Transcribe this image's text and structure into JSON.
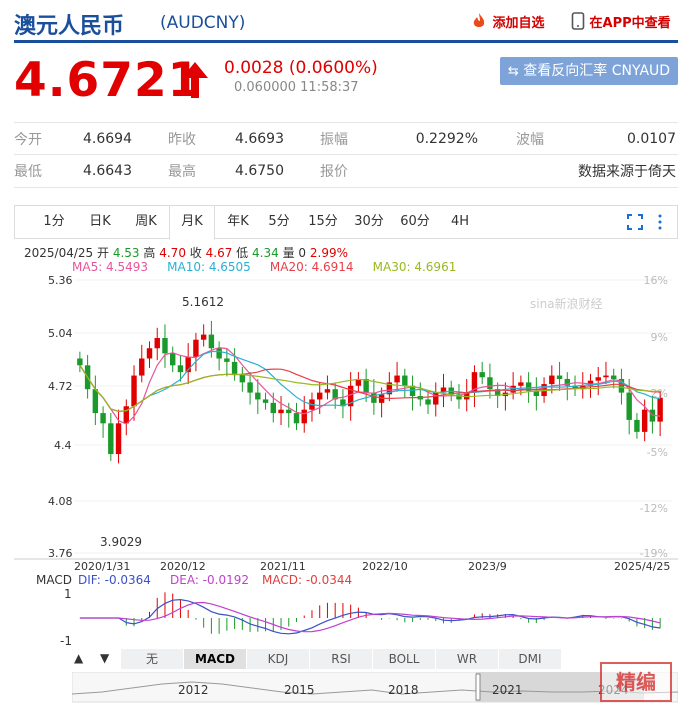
{
  "header": {
    "title": "澳元人民币",
    "code": "(AUDCNY)",
    "add_watchlist": "添加自选",
    "open_app": "在APP中查看"
  },
  "quote": {
    "price": "4.6721",
    "change": "0.0028 (0.0600%)",
    "bid_time": "0.060000 11:58:37",
    "reverse_button": "查看反向汇率 CNYAUD"
  },
  "stats": [
    [
      {
        "label": "今开",
        "value": "4.6694"
      },
      {
        "label": "昨收",
        "value": "4.6693"
      },
      {
        "label": "振幅",
        "value": "0.2292%"
      },
      {
        "label": "波幅",
        "value": "0.0107"
      }
    ],
    [
      {
        "label": "最低",
        "value": "4.6643"
      },
      {
        "label": "最高",
        "value": "4.6750"
      },
      {
        "label": "报价",
        "value": ""
      },
      {
        "label": "",
        "value": "数据来源于倚天"
      }
    ]
  ],
  "period_tabs": [
    "1分",
    "日K",
    "周K",
    "月K",
    "年K",
    "5分",
    "15分",
    "30分",
    "60分",
    "4H"
  ],
  "active_tab": "月K",
  "legend": {
    "date": "2025/04/25",
    "open_label": "开",
    "open": "4.53",
    "high_label": "高",
    "high": "4.70",
    "close_label": "收",
    "close": "4.67",
    "low_label": "低",
    "low": "4.34",
    "vol_label": "量",
    "vol": "0",
    "pct": "2.99%",
    "ma5": "MA5: 4.5493",
    "ma10": "MA10: 4.6505",
    "ma20": "MA20: 4.6914",
    "ma30": "MA30: 4.6961"
  },
  "colors": {
    "up": "#e00000",
    "down": "#1a9a2a",
    "ma5": "#e8559a",
    "ma10": "#2ab0d4",
    "ma20": "#e8404a",
    "ma30": "#9ab820",
    "dif": "#3a50c8",
    "dea": "#c040d0"
  },
  "chart": {
    "y_left": [
      "5.36",
      "5.04",
      "4.72",
      "4.4",
      "4.08",
      "3.76"
    ],
    "y_right": [
      "16%",
      "9%",
      "2%",
      "-5%",
      "-12%",
      "-19%"
    ],
    "x_labels": [
      "2020/1/31",
      "2020/12",
      "2021/11",
      "2022/10",
      "2023/9",
      "2025/4/25"
    ],
    "high_mark": "5.1612",
    "low_mark": "3.9029",
    "watermark": "sina新浪财经"
  },
  "macd": {
    "title": "MACD",
    "dif": "DIF: -0.0364",
    "dea": "DEA: -0.0192",
    "macd": "MACD: -0.0344",
    "y_top": "1",
    "y_bottom": "-1"
  },
  "indicator_tabs": [
    "无",
    "MACD",
    "KDJ",
    "RSI",
    "BOLL",
    "WR",
    "DMI"
  ],
  "active_indicator": "MACD",
  "timeline_years": [
    "2012",
    "2015",
    "2018",
    "2021",
    "2024"
  ],
  "badge_text": "精编"
}
